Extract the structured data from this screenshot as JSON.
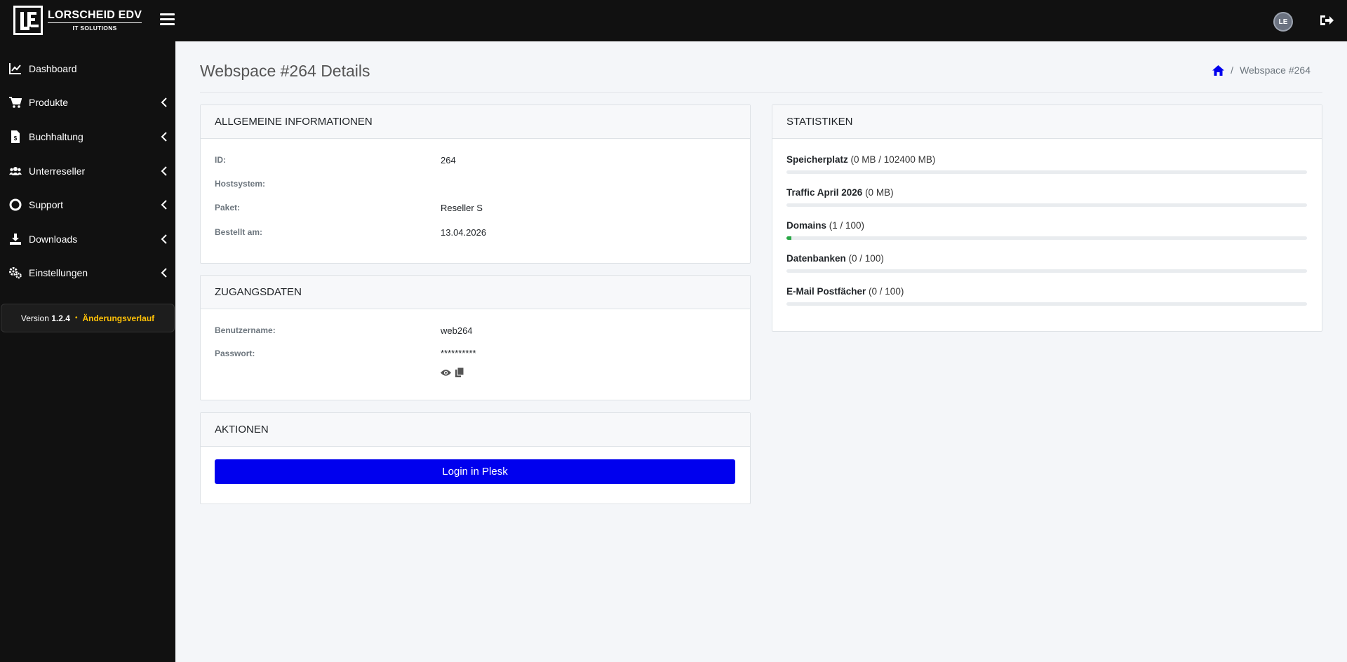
{
  "brand": {
    "name": "LORSCHEID EDV",
    "sub": "IT SOLUTIONS",
    "avatar_text": "LE"
  },
  "sidebar": {
    "items": [
      {
        "label": "Dashboard",
        "icon": "chart-line-icon",
        "expandable": false
      },
      {
        "label": "Produkte",
        "icon": "cart-icon",
        "expandable": true
      },
      {
        "label": "Buchhaltung",
        "icon": "invoice-icon",
        "expandable": true
      },
      {
        "label": "Unterreseller",
        "icon": "users-icon",
        "expandable": true
      },
      {
        "label": "Support",
        "icon": "lifebuoy-icon",
        "expandable": true
      },
      {
        "label": "Downloads",
        "icon": "download-icon",
        "expandable": true
      },
      {
        "label": "Einstellungen",
        "icon": "gears-icon",
        "expandable": true
      }
    ],
    "version": {
      "prefix": "Version",
      "number": "1.2.4",
      "link": "Änderungsverlauf"
    }
  },
  "page": {
    "title": "Webspace #264 Details",
    "breadcrumb_current": "Webspace #264"
  },
  "general": {
    "header": "Allgemeine Informationen",
    "rows": [
      {
        "label": "ID:",
        "value": "264"
      },
      {
        "label": "Hostsystem:",
        "value": ""
      },
      {
        "label": "Paket:",
        "value": "Reseller S"
      },
      {
        "label": "Bestellt am:",
        "value": "13.04.2026"
      }
    ]
  },
  "access": {
    "header": "Zugangsdaten",
    "username_label": "Benutzername:",
    "username": "web264",
    "password_label": "Passwort:",
    "password": "**********"
  },
  "actions": {
    "header": "Aktionen",
    "login_button": "Login in Plesk"
  },
  "stats": {
    "header": "Statistiken",
    "items": [
      {
        "name": "Speicherplatz",
        "detail": "(0 MB / 102400 MB)",
        "fraction": 0.0
      },
      {
        "name": "Traffic April 2026",
        "detail": "(0 MB)",
        "fraction": 0.0
      },
      {
        "name": "Domains",
        "detail": "(1 / 100)",
        "fraction": 0.01
      },
      {
        "name": "Datenbanken",
        "detail": "(0 / 100)",
        "fraction": 0.0
      },
      {
        "name": "E-Mail Postfächer",
        "detail": "(0 / 100)",
        "fraction": 0.0
      }
    ]
  },
  "colors": {
    "primary": "#0000ee",
    "accent": "#ffc107",
    "success": "#28a745",
    "dark": "#111111"
  }
}
